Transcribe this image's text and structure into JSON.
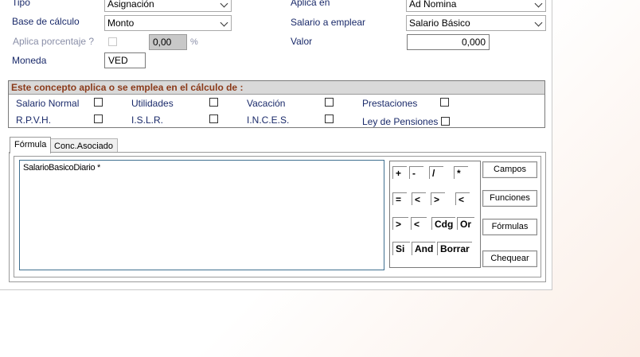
{
  "fields": {
    "tipo_label": "Tipo",
    "tipo_value": "Asignación",
    "base_label": "Base de cálculo",
    "base_value": "Monto",
    "aplica_pct_label": "Aplica porcentaje ?",
    "pct_value": "0,00",
    "pct_sign": "%",
    "moneda_label": "Moneda",
    "moneda_value": "VED",
    "aplica_en_label": "Aplica en",
    "aplica_en_value": "Ad Nomina",
    "salario_label": "Salario a emplear",
    "salario_value": "Salario Básico",
    "valor_label": "Valor",
    "valor_value": "0,000"
  },
  "concept_group": {
    "title": "Este concepto aplica o se emplea en el cálculo de :",
    "items": [
      {
        "label": "Salario Normal",
        "checked": false
      },
      {
        "label": "Utilidades",
        "checked": false
      },
      {
        "label": "Vacación",
        "checked": false
      },
      {
        "label": "Prestaciones",
        "checked": false
      },
      {
        "label": "R.P.V.H.",
        "checked": false
      },
      {
        "label": "I.S.L.R.",
        "checked": false
      },
      {
        "label": "I.N.C.E.S.",
        "checked": false
      },
      {
        "label": "Ley de Pensiones",
        "checked": false
      }
    ]
  },
  "tabs": [
    {
      "label": "Fórmula",
      "active": true
    },
    {
      "label": "Conc.Asociado",
      "active": false
    }
  ],
  "formula_text": "SalarioBasicoDiario *",
  "operators": [
    "+",
    "-",
    "/",
    "*",
    "=",
    "<",
    ">",
    "<",
    ">",
    "<",
    "Cdg",
    "Or",
    "Si",
    "And",
    "Borrar"
  ],
  "buttons": {
    "campos": "Campos",
    "funciones": "Funciones",
    "formulas": "Fórmulas",
    "chequear": "Chequear"
  },
  "colors": {
    "group_title": "#8b3a1a",
    "label_text": "#1a2a6a"
  }
}
